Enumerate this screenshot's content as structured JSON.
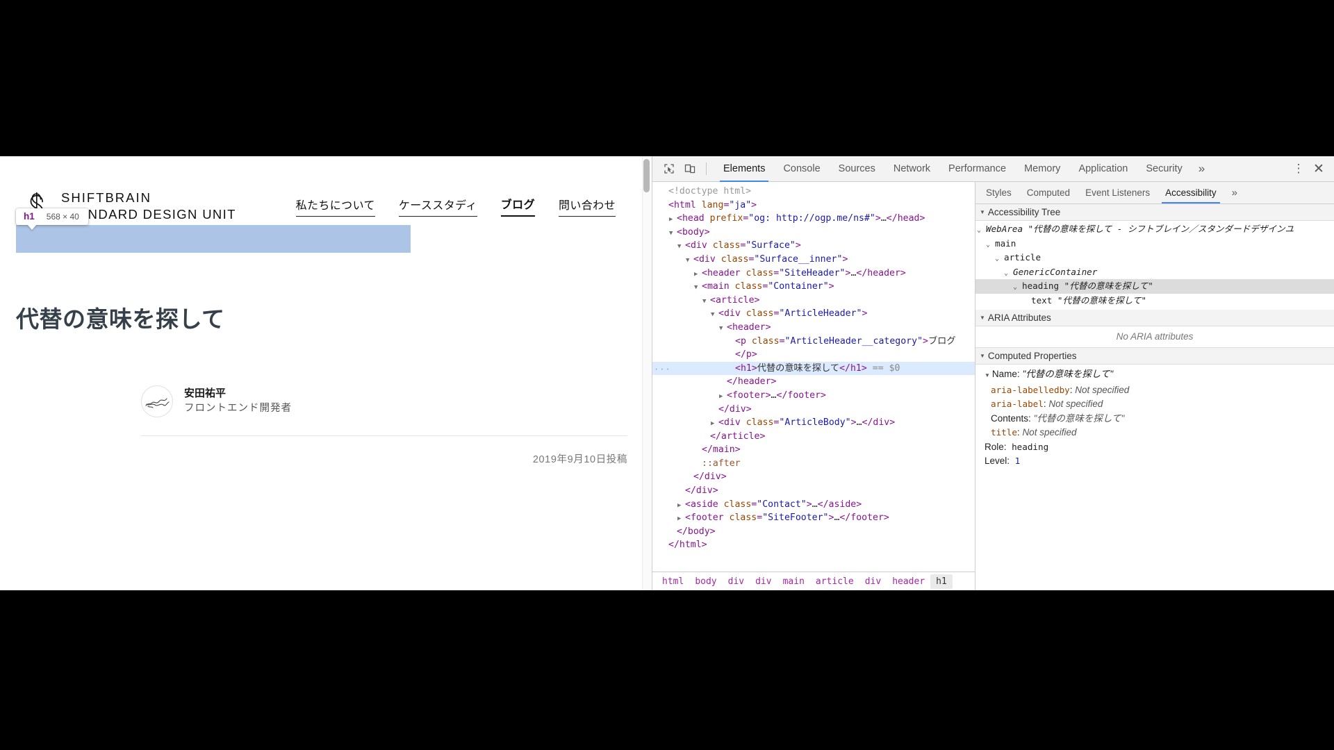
{
  "webpage": {
    "logo": {
      "line1": "SHIFTBRAIN",
      "line2": "STANDARD DESIGN UNIT",
      "icon": "shiftbrain-s-logo-icon"
    },
    "nav": [
      {
        "label": "私たちについて",
        "active": false
      },
      {
        "label": "ケーススタディ",
        "active": false
      },
      {
        "label": "ブログ",
        "active": true
      },
      {
        "label": "問い合わせ",
        "active": false
      }
    ],
    "inspector_badge": {
      "tag": "h1",
      "dimensions": "568 × 40"
    },
    "article": {
      "title": "代替の意味を探して",
      "author_name": "安田祐平",
      "author_role": "フロントエンド開発者",
      "post_date": "2019年9月10日投稿"
    }
  },
  "devtools": {
    "toolbar": {
      "inspect_icon": "inspect-element-icon",
      "device_icon": "device-toolbar-icon",
      "kebab_label": "⋮",
      "close_label": "✕",
      "tabs": [
        {
          "label": "Elements",
          "active": true
        },
        {
          "label": "Console",
          "active": false
        },
        {
          "label": "Sources",
          "active": false
        },
        {
          "label": "Network",
          "active": false
        },
        {
          "label": "Performance",
          "active": false
        },
        {
          "label": "Memory",
          "active": false
        },
        {
          "label": "Application",
          "active": false
        },
        {
          "label": "Security",
          "active": false
        }
      ],
      "more_label": "»"
    },
    "dom_tree": [
      {
        "indent": 0,
        "twisty": "none",
        "selected": false,
        "parts": [
          {
            "t": "comment",
            "v": "<!doctype html>"
          }
        ]
      },
      {
        "indent": 0,
        "twisty": "none",
        "selected": false,
        "parts": [
          {
            "t": "punct",
            "v": "<"
          },
          {
            "t": "tag",
            "v": "html"
          },
          {
            "t": "sp",
            "v": " "
          },
          {
            "t": "attr",
            "v": "lang"
          },
          {
            "t": "punct",
            "v": "="
          },
          {
            "t": "val",
            "v": "\"ja\""
          },
          {
            "t": "punct",
            "v": ">"
          }
        ]
      },
      {
        "indent": 1,
        "twisty": "right",
        "selected": false,
        "parts": [
          {
            "t": "punct",
            "v": "<"
          },
          {
            "t": "tag",
            "v": "head"
          },
          {
            "t": "sp",
            "v": " "
          },
          {
            "t": "attr",
            "v": "prefix"
          },
          {
            "t": "punct",
            "v": "="
          },
          {
            "t": "val",
            "v": "\"og: http://ogp.me/ns#\""
          },
          {
            "t": "punct",
            "v": ">"
          },
          {
            "t": "text",
            "v": "…"
          },
          {
            "t": "punct",
            "v": "</"
          },
          {
            "t": "tag",
            "v": "head"
          },
          {
            "t": "punct",
            "v": ">"
          }
        ]
      },
      {
        "indent": 1,
        "twisty": "down",
        "selected": false,
        "parts": [
          {
            "t": "punct",
            "v": "<"
          },
          {
            "t": "tag",
            "v": "body"
          },
          {
            "t": "punct",
            "v": ">"
          }
        ]
      },
      {
        "indent": 2,
        "twisty": "down",
        "selected": false,
        "parts": [
          {
            "t": "punct",
            "v": "<"
          },
          {
            "t": "tag",
            "v": "div"
          },
          {
            "t": "sp",
            "v": " "
          },
          {
            "t": "attr",
            "v": "class"
          },
          {
            "t": "punct",
            "v": "="
          },
          {
            "t": "val",
            "v": "\"Surface\""
          },
          {
            "t": "punct",
            "v": ">"
          }
        ]
      },
      {
        "indent": 3,
        "twisty": "down",
        "selected": false,
        "parts": [
          {
            "t": "punct",
            "v": "<"
          },
          {
            "t": "tag",
            "v": "div"
          },
          {
            "t": "sp",
            "v": " "
          },
          {
            "t": "attr",
            "v": "class"
          },
          {
            "t": "punct",
            "v": "="
          },
          {
            "t": "val",
            "v": "\"Surface__inner\""
          },
          {
            "t": "punct",
            "v": ">"
          }
        ]
      },
      {
        "indent": 4,
        "twisty": "right",
        "selected": false,
        "parts": [
          {
            "t": "punct",
            "v": "<"
          },
          {
            "t": "tag",
            "v": "header"
          },
          {
            "t": "sp",
            "v": " "
          },
          {
            "t": "attr",
            "v": "class"
          },
          {
            "t": "punct",
            "v": "="
          },
          {
            "t": "val",
            "v": "\"SiteHeader\""
          },
          {
            "t": "punct",
            "v": ">"
          },
          {
            "t": "text",
            "v": "…"
          },
          {
            "t": "punct",
            "v": "</"
          },
          {
            "t": "tag",
            "v": "header"
          },
          {
            "t": "punct",
            "v": ">"
          }
        ]
      },
      {
        "indent": 4,
        "twisty": "down",
        "selected": false,
        "parts": [
          {
            "t": "punct",
            "v": "<"
          },
          {
            "t": "tag",
            "v": "main"
          },
          {
            "t": "sp",
            "v": " "
          },
          {
            "t": "attr",
            "v": "class"
          },
          {
            "t": "punct",
            "v": "="
          },
          {
            "t": "val",
            "v": "\"Container\""
          },
          {
            "t": "punct",
            "v": ">"
          }
        ]
      },
      {
        "indent": 5,
        "twisty": "down",
        "selected": false,
        "parts": [
          {
            "t": "punct",
            "v": "<"
          },
          {
            "t": "tag",
            "v": "article"
          },
          {
            "t": "punct",
            "v": ">"
          }
        ]
      },
      {
        "indent": 6,
        "twisty": "down",
        "selected": false,
        "parts": [
          {
            "t": "punct",
            "v": "<"
          },
          {
            "t": "tag",
            "v": "div"
          },
          {
            "t": "sp",
            "v": " "
          },
          {
            "t": "attr",
            "v": "class"
          },
          {
            "t": "punct",
            "v": "="
          },
          {
            "t": "val",
            "v": "\"ArticleHeader\""
          },
          {
            "t": "punct",
            "v": ">"
          }
        ]
      },
      {
        "indent": 7,
        "twisty": "down",
        "selected": false,
        "parts": [
          {
            "t": "punct",
            "v": "<"
          },
          {
            "t": "tag",
            "v": "header"
          },
          {
            "t": "punct",
            "v": ">"
          }
        ]
      },
      {
        "indent": 8,
        "twisty": "none",
        "selected": false,
        "parts": [
          {
            "t": "punct",
            "v": "<"
          },
          {
            "t": "tag",
            "v": "p"
          },
          {
            "t": "sp",
            "v": " "
          },
          {
            "t": "attr",
            "v": "class"
          },
          {
            "t": "punct",
            "v": "="
          },
          {
            "t": "val",
            "v": "\"ArticleHeader__category\""
          },
          {
            "t": "punct",
            "v": ">"
          },
          {
            "t": "text",
            "v": "ブログ"
          }
        ]
      },
      {
        "indent": 8,
        "twisty": "none",
        "selected": false,
        "parts": [
          {
            "t": "punct",
            "v": "</"
          },
          {
            "t": "tag",
            "v": "p"
          },
          {
            "t": "punct",
            "v": ">"
          }
        ]
      },
      {
        "indent": 8,
        "twisty": "none",
        "selected": true,
        "parts": [
          {
            "t": "punct",
            "v": "<"
          },
          {
            "t": "tag",
            "v": "h1"
          },
          {
            "t": "punct",
            "v": ">"
          },
          {
            "t": "text",
            "v": "代替の意味を探して"
          },
          {
            "t": "punct",
            "v": "</"
          },
          {
            "t": "tag",
            "v": "h1"
          },
          {
            "t": "punct",
            "v": ">"
          },
          {
            "t": "sel",
            "v": "  ==  $0"
          }
        ]
      },
      {
        "indent": 7,
        "twisty": "none",
        "selected": false,
        "parts": [
          {
            "t": "punct",
            "v": "</"
          },
          {
            "t": "tag",
            "v": "header"
          },
          {
            "t": "punct",
            "v": ">"
          }
        ]
      },
      {
        "indent": 7,
        "twisty": "right",
        "selected": false,
        "parts": [
          {
            "t": "punct",
            "v": "<"
          },
          {
            "t": "tag",
            "v": "footer"
          },
          {
            "t": "punct",
            "v": ">"
          },
          {
            "t": "text",
            "v": "…"
          },
          {
            "t": "punct",
            "v": "</"
          },
          {
            "t": "tag",
            "v": "footer"
          },
          {
            "t": "punct",
            "v": ">"
          }
        ]
      },
      {
        "indent": 6,
        "twisty": "none",
        "selected": false,
        "parts": [
          {
            "t": "punct",
            "v": "</"
          },
          {
            "t": "tag",
            "v": "div"
          },
          {
            "t": "punct",
            "v": ">"
          }
        ]
      },
      {
        "indent": 6,
        "twisty": "right",
        "selected": false,
        "parts": [
          {
            "t": "punct",
            "v": "<"
          },
          {
            "t": "tag",
            "v": "div"
          },
          {
            "t": "sp",
            "v": " "
          },
          {
            "t": "attr",
            "v": "class"
          },
          {
            "t": "punct",
            "v": "="
          },
          {
            "t": "val",
            "v": "\"ArticleBody\""
          },
          {
            "t": "punct",
            "v": ">"
          },
          {
            "t": "text",
            "v": "…"
          },
          {
            "t": "punct",
            "v": "</"
          },
          {
            "t": "tag",
            "v": "div"
          },
          {
            "t": "punct",
            "v": ">"
          }
        ]
      },
      {
        "indent": 5,
        "twisty": "none",
        "selected": false,
        "parts": [
          {
            "t": "punct",
            "v": "</"
          },
          {
            "t": "tag",
            "v": "article"
          },
          {
            "t": "punct",
            "v": ">"
          }
        ]
      },
      {
        "indent": 4,
        "twisty": "none",
        "selected": false,
        "parts": [
          {
            "t": "punct",
            "v": "</"
          },
          {
            "t": "tag",
            "v": "main"
          },
          {
            "t": "punct",
            "v": ">"
          }
        ]
      },
      {
        "indent": 4,
        "twisty": "none",
        "selected": false,
        "parts": [
          {
            "t": "pseudo",
            "v": "::after"
          }
        ]
      },
      {
        "indent": 3,
        "twisty": "none",
        "selected": false,
        "parts": [
          {
            "t": "punct",
            "v": "</"
          },
          {
            "t": "tag",
            "v": "div"
          },
          {
            "t": "punct",
            "v": ">"
          }
        ]
      },
      {
        "indent": 2,
        "twisty": "none",
        "selected": false,
        "parts": [
          {
            "t": "punct",
            "v": "</"
          },
          {
            "t": "tag",
            "v": "div"
          },
          {
            "t": "punct",
            "v": ">"
          }
        ]
      },
      {
        "indent": 2,
        "twisty": "right",
        "selected": false,
        "parts": [
          {
            "t": "punct",
            "v": "<"
          },
          {
            "t": "tag",
            "v": "aside"
          },
          {
            "t": "sp",
            "v": " "
          },
          {
            "t": "attr",
            "v": "class"
          },
          {
            "t": "punct",
            "v": "="
          },
          {
            "t": "val",
            "v": "\"Contact\""
          },
          {
            "t": "punct",
            "v": ">"
          },
          {
            "t": "text",
            "v": "…"
          },
          {
            "t": "punct",
            "v": "</"
          },
          {
            "t": "tag",
            "v": "aside"
          },
          {
            "t": "punct",
            "v": ">"
          }
        ]
      },
      {
        "indent": 2,
        "twisty": "right",
        "selected": false,
        "parts": [
          {
            "t": "punct",
            "v": "<"
          },
          {
            "t": "tag",
            "v": "footer"
          },
          {
            "t": "sp",
            "v": " "
          },
          {
            "t": "attr",
            "v": "class"
          },
          {
            "t": "punct",
            "v": "="
          },
          {
            "t": "val",
            "v": "\"SiteFooter\""
          },
          {
            "t": "punct",
            "v": ">"
          },
          {
            "t": "text",
            "v": "…"
          },
          {
            "t": "punct",
            "v": "</"
          },
          {
            "t": "tag",
            "v": "footer"
          },
          {
            "t": "punct",
            "v": ">"
          }
        ]
      },
      {
        "indent": 1,
        "twisty": "none",
        "selected": false,
        "parts": [
          {
            "t": "punct",
            "v": "</"
          },
          {
            "t": "tag",
            "v": "body"
          },
          {
            "t": "punct",
            "v": ">"
          }
        ]
      },
      {
        "indent": 0,
        "twisty": "none",
        "selected": false,
        "parts": [
          {
            "t": "punct",
            "v": "</"
          },
          {
            "t": "tag",
            "v": "html"
          },
          {
            "t": "punct",
            "v": ">"
          }
        ]
      }
    ],
    "breadcrumb": [
      {
        "label": "html",
        "active": false
      },
      {
        "label": "body",
        "active": false
      },
      {
        "label": "div",
        "active": false
      },
      {
        "label": "div",
        "active": false
      },
      {
        "label": "main",
        "active": false
      },
      {
        "label": "article",
        "active": false
      },
      {
        "label": "div",
        "active": false
      },
      {
        "label": "header",
        "active": false
      },
      {
        "label": "h1",
        "active": true
      }
    ],
    "sidebar": {
      "tabs": [
        {
          "label": "Styles",
          "active": false
        },
        {
          "label": "Computed",
          "active": false
        },
        {
          "label": "Event Listeners",
          "active": false
        },
        {
          "label": "Accessibility",
          "active": true
        }
      ],
      "more_label": "»",
      "accessibility_tree": {
        "title": "Accessibility Tree",
        "rows": [
          {
            "indent": 0,
            "role": "WebArea",
            "name": "\"代替の意味を探して - シフトブレイン／スタンダードデザインユ",
            "italic_role": true,
            "selected": false
          },
          {
            "indent": 1,
            "role": "main",
            "name": "",
            "italic_role": false,
            "selected": false
          },
          {
            "indent": 2,
            "role": "article",
            "name": "",
            "italic_role": false,
            "selected": false
          },
          {
            "indent": 3,
            "role": "GenericContainer",
            "name": "",
            "italic_role": true,
            "selected": false
          },
          {
            "indent": 4,
            "role": "heading",
            "name": "\"代替の意味を探して\"",
            "italic_role": false,
            "selected": true
          },
          {
            "indent": 5,
            "role": "text",
            "name": "\"代替の意味を探して\"",
            "italic_role": false,
            "selected": false,
            "no_chevron": true
          }
        ]
      },
      "aria_attributes": {
        "title": "ARIA Attributes",
        "empty_text": "No ARIA attributes"
      },
      "computed_properties": {
        "title": "Computed Properties",
        "name_label": "Name:",
        "name_value": "\"代替の意味を探して\"",
        "rows": [
          {
            "key": "aria-labelledby",
            "key_mono": true,
            "sep": ":",
            "value": "Not specified",
            "italic": true
          },
          {
            "key": "aria-label",
            "key_mono": true,
            "sep": ":",
            "value": "Not specified",
            "italic": true
          },
          {
            "key": "Contents",
            "key_mono": false,
            "sep": ":",
            "value": "\"代替の意味を探して\"",
            "italic": true
          },
          {
            "key": "title",
            "key_mono": true,
            "sep": ":",
            "value": "Not specified",
            "italic": true
          }
        ],
        "role_label": "Role:",
        "role_value": "heading",
        "level_label": "Level:",
        "level_value": "1"
      }
    }
  }
}
